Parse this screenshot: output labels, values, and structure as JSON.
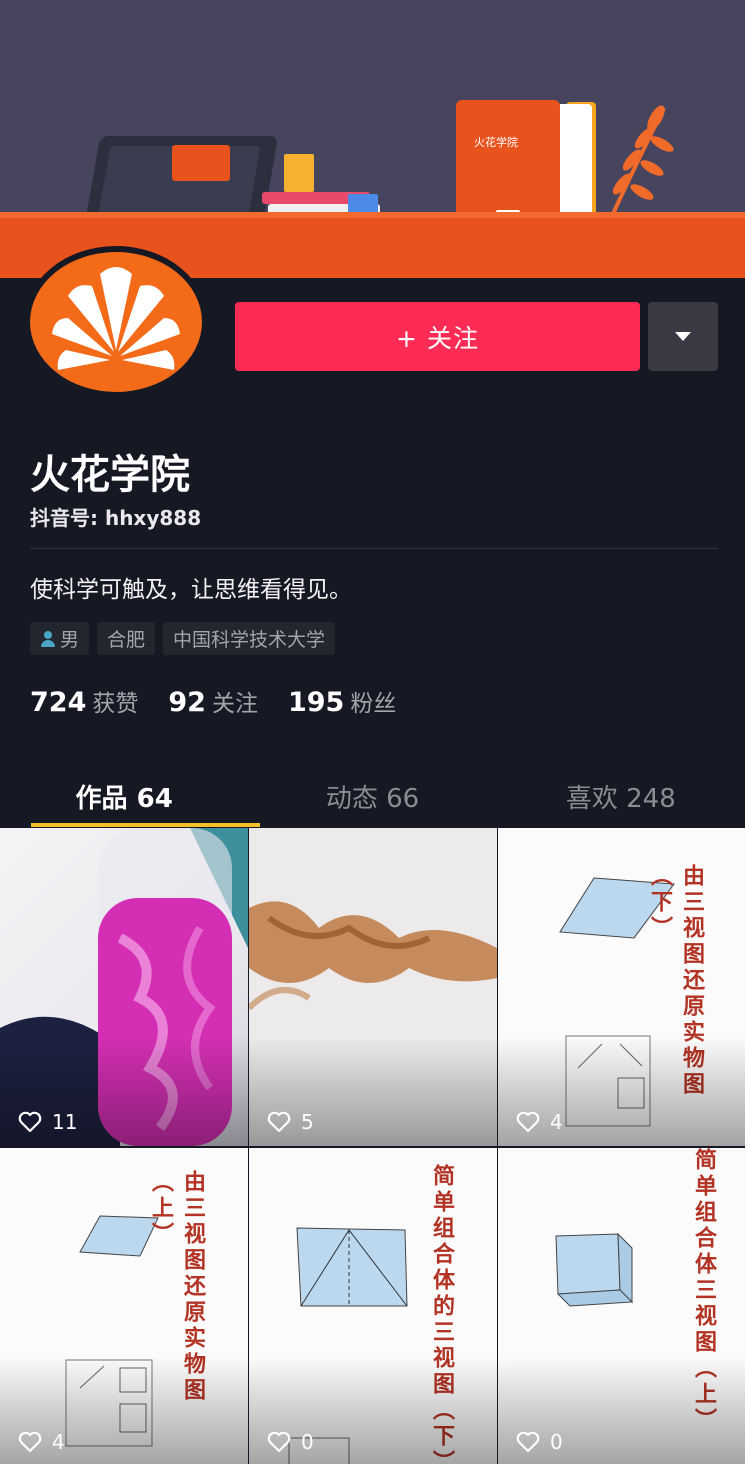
{
  "banner": {
    "logo_text": "火花学院"
  },
  "profile": {
    "name": "火花学院",
    "handle": "抖音号: hhxy888",
    "bio": "使科学可触及，让思维看得见。",
    "tags": [
      "男",
      "合肥",
      "中国科学技术大学"
    ],
    "stats": [
      {
        "num": "724",
        "label": "获赞"
      },
      {
        "num": "92",
        "label": "关注"
      },
      {
        "num": "195",
        "label": "粉丝"
      }
    ]
  },
  "actions": {
    "follow_label": "+ 关注"
  },
  "tabs": [
    {
      "label": "作品 64",
      "active": true
    },
    {
      "label": "动态 66",
      "active": false
    },
    {
      "label": "喜欢 248",
      "active": false
    }
  ],
  "videos": [
    {
      "likes": "11",
      "overlay": ""
    },
    {
      "likes": "5",
      "overlay": ""
    },
    {
      "likes": "4",
      "overlay": "由三视图还原实物图（下）"
    },
    {
      "likes": "4",
      "overlay": "由三视图还原实物图（上）"
    },
    {
      "likes": "0",
      "overlay": "简单组合体的三视图（下）"
    },
    {
      "likes": "0",
      "overlay": "简单组合体三视图（上）"
    }
  ],
  "colors": {
    "background": "#161823",
    "follow_button": "#fe2c55",
    "brand_orange": "#f36a18",
    "tab_indicator": "#f5c12a"
  }
}
